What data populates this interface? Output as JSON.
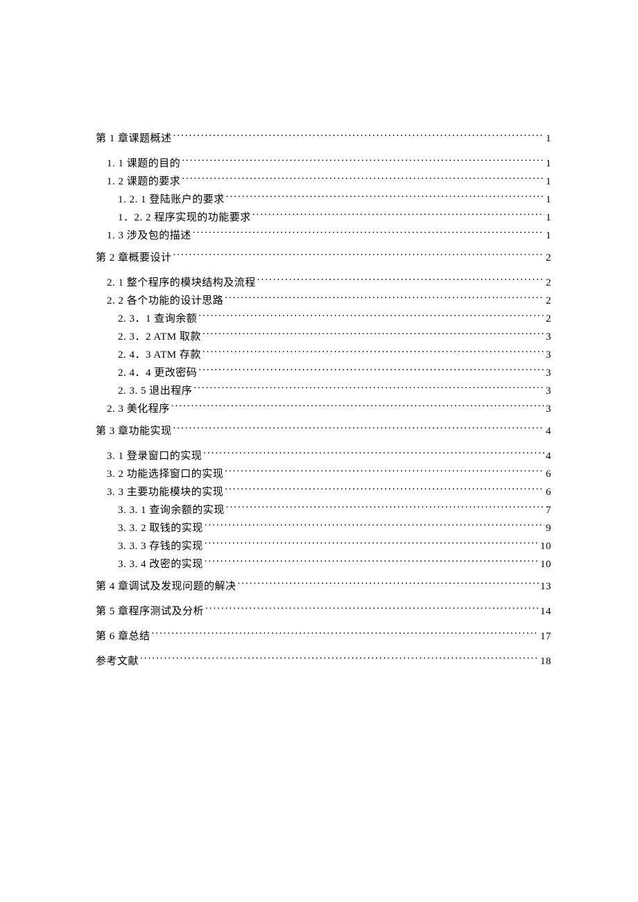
{
  "toc": [
    {
      "level": 0,
      "label": "第 1 章课题概述",
      "page": "1"
    },
    {
      "level": 1,
      "label": "1. 1   课题的目的",
      "page": "1"
    },
    {
      "level": 1,
      "label": "1. 2   课题的要求",
      "page": "1"
    },
    {
      "level": 2,
      "label": "1. 2. 1 登陆账户的要求",
      "page": "1"
    },
    {
      "level": 2,
      "label": "1．2. 2 程序实现的功能要求",
      "page": "1"
    },
    {
      "level": 1,
      "label": "1. 3 涉及包的描述",
      "page": "1"
    },
    {
      "level": 0,
      "label": "第 2 章概要设计",
      "page": "2"
    },
    {
      "level": 1,
      "label": "2. 1   整个程序的模块结构及流程",
      "page": "2"
    },
    {
      "level": 1,
      "label": "2. 2   各个功能的设计思路",
      "page": "2"
    },
    {
      "level": 2,
      "label": "2. 3．1 查询余额",
      "page": "2"
    },
    {
      "level": 2,
      "label": "2. 3．2 ATM 取款",
      "page": "3"
    },
    {
      "level": 2,
      "label": "2. 4．3 ATM 存款",
      "page": "3"
    },
    {
      "level": 2,
      "label": "2. 4．4 更改密码",
      "page": "3"
    },
    {
      "level": 2,
      "label": "2. 3. 5 退出程序",
      "page": "3"
    },
    {
      "level": 1,
      "label": "2. 3 美化程序",
      "page": "3"
    },
    {
      "level": 0,
      "label": "第 3 章功能实现",
      "page": "4"
    },
    {
      "level": 1,
      "label": "3. 1 登录窗口的实现",
      "page": "4"
    },
    {
      "level": 1,
      "label": "3. 2 功能选择窗口的实现",
      "page": "6"
    },
    {
      "level": 1,
      "label": "3. 3 主要功能模块的实现",
      "page": "6"
    },
    {
      "level": 2,
      "label": "3. 3. 1 查询余额的实现",
      "page": "7"
    },
    {
      "level": 2,
      "label": "3. 3. 2 取钱的实现",
      "page": "9"
    },
    {
      "level": 2,
      "label": "3. 3. 3 存钱的实现",
      "page": "10"
    },
    {
      "level": 2,
      "label": "3. 3. 4 改密的实现",
      "page": "10"
    },
    {
      "level": 0,
      "label": "第 4 章调试及发现问题的解决",
      "page": "13"
    },
    {
      "level": 0,
      "label": "第 5 章程序测试及分析",
      "page": "14"
    },
    {
      "level": 0,
      "label": "第 6 章总结",
      "page": "17"
    },
    {
      "level": 0,
      "label": "参考文献",
      "page": "18"
    }
  ]
}
